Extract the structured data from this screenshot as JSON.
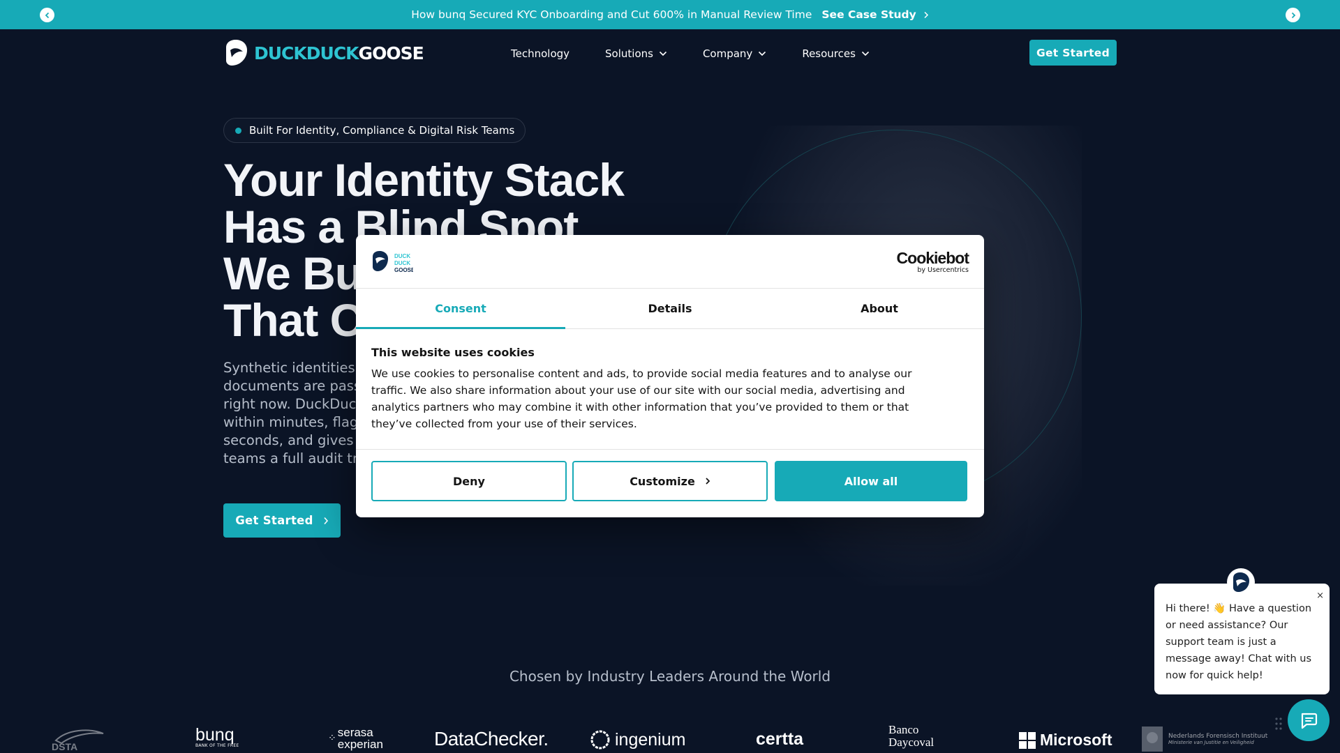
{
  "announcement": {
    "message": "How bunq Secured KYC Onboarding and Cut 600% in Manual Review Time",
    "cta": "See Case Study"
  },
  "nav": {
    "logo_duck": "DUCKDUCK",
    "logo_goose": "GOOSE",
    "items": [
      "Technology",
      "Solutions",
      "Company",
      "Resources"
    ],
    "cta": "Get Started"
  },
  "hero": {
    "pill": "Built For Identity, Compliance & Digital Risk Teams",
    "headline_lines": [
      "Your Identity Stack",
      "Has a Blind Spot.",
      "We Bu",
      "That C"
    ],
    "subtext_lines": [
      "Synthetic identities,",
      "documents are passi",
      "right now. DuckDuck",
      "within minutes, flags",
      "seconds, and gives y",
      "teams a full audit tra"
    ],
    "cta": "Get Started"
  },
  "clients": {
    "heading": "Chosen by Industry Leaders Around the World",
    "logos": [
      "DSTA",
      "bunq",
      "serasa experian",
      "DataChecker.",
      "ingenium",
      "certta",
      "Banco Daycoval",
      "Microsoft",
      "Nederlands Forensisch Instituut"
    ],
    "bunq_tag": "BANK OF THE FREE",
    "nfi_tag": "Ministerie van Justitie en Veiligheid"
  },
  "cookie": {
    "brand": "Cookiebot",
    "brand_by": "by Usercentrics",
    "logo_lines": [
      "DUCK",
      "DUCK",
      "GOOSE"
    ],
    "tabs": [
      "Consent",
      "Details",
      "About"
    ],
    "title": "This website uses cookies",
    "body_lines": [
      "We use cookies to personalise content and ads, to provide social media features and to analyse our",
      "traffic. We also share information about your use of our site with our social media, advertising and",
      "analytics partners who may combine it with other information that you’ve provided to them or that",
      "they’ve collected from your use of their services."
    ],
    "deny": "Deny",
    "customize": "Customize",
    "allow": "Allow all"
  },
  "chat": {
    "message": "Hi there! 👋 Have a question or need assistance? Our support team is just a message away! Chat with us now for quick help!",
    "close": "×"
  },
  "colors": {
    "accent": "#17aab7",
    "background": "#0b1426"
  }
}
